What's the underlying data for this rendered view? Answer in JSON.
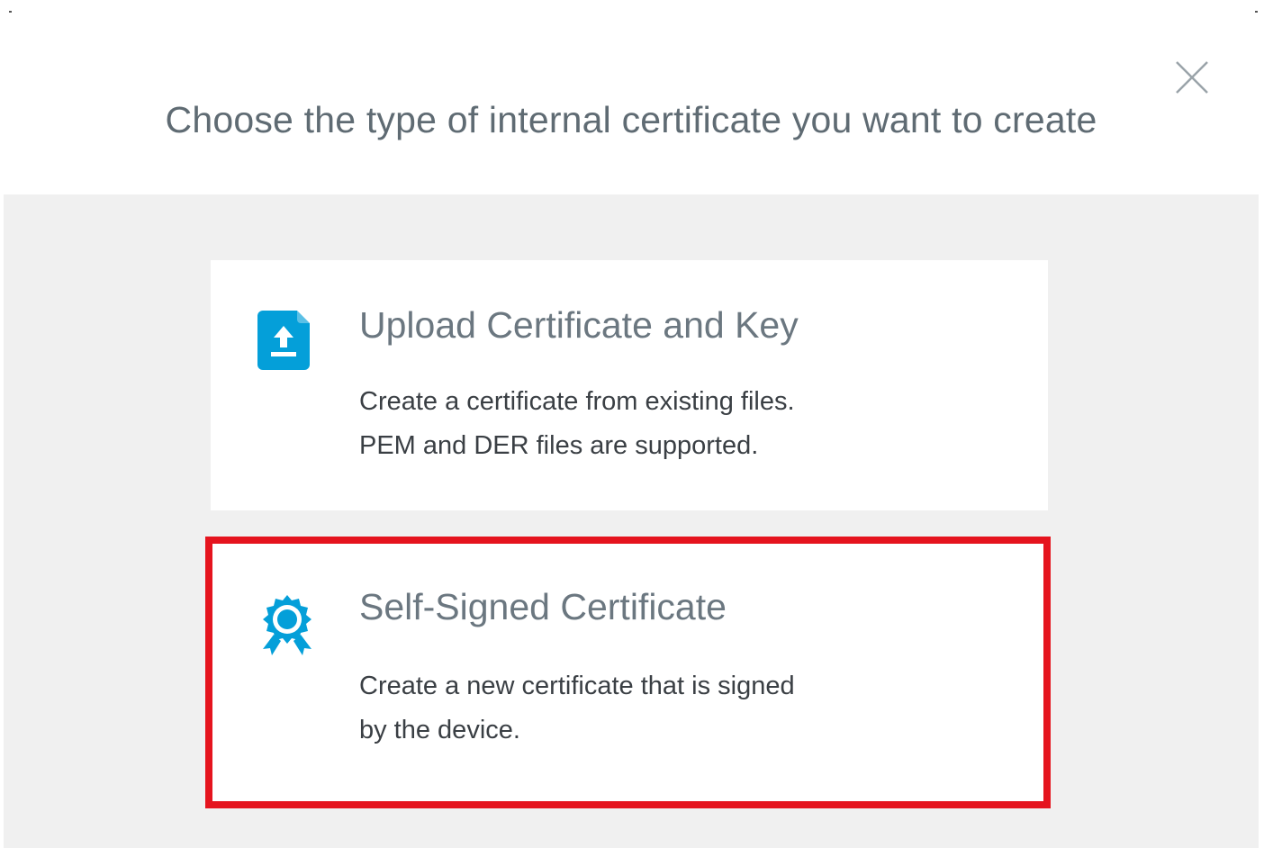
{
  "dialog": {
    "title": "Choose the type of internal certificate you want to create",
    "close_icon": "close-icon"
  },
  "options": [
    {
      "icon": "upload-file-icon",
      "title": "Upload Certificate and Key",
      "description_line1": "Create a certificate from existing files.",
      "description_line2": "PEM and DER files are supported."
    },
    {
      "icon": "certificate-badge-icon",
      "title": "Self-Signed Certificate",
      "description_line1": "Create a new certificate that is signed",
      "description_line2": "by the device.",
      "highlighted": true
    }
  ],
  "colors": {
    "accent": "#049fd9",
    "highlight": "#e5141e",
    "body_background": "#f0f0f0"
  }
}
